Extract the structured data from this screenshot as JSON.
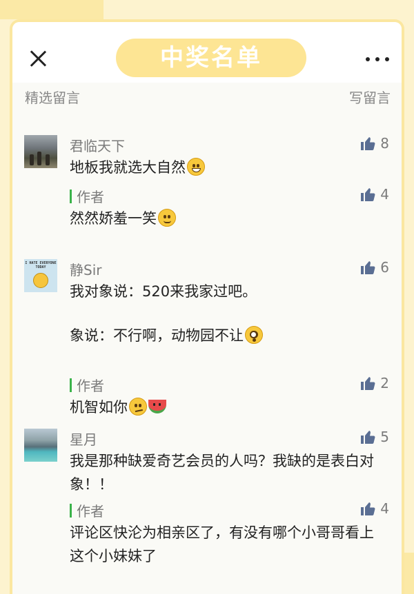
{
  "header": {
    "title": "中奖名单",
    "section_label": "精选留言",
    "write_label": "写留言"
  },
  "comments": [
    {
      "author": "君临天下",
      "likes": "8",
      "text": "地板我就选大自然",
      "emoji": "grin-emoji",
      "reply": {
        "label": "作者",
        "likes": "4",
        "text": "然然娇羞一笑",
        "emoji": "shy-smile-emoji"
      }
    },
    {
      "author": "静Sir",
      "likes": "6",
      "avatar_text": "I HATE EVERYONE TODAY",
      "text_line1": "我对象说：520来我家过吧。",
      "text_line2": "象说：不行啊，动物园不让",
      "emoji": "flushed-emoji",
      "reply": {
        "label": "作者",
        "likes": "2",
        "text": "机智如你",
        "emoji": "smirk-emoji",
        "emoji2": "watermelon-emoji"
      }
    },
    {
      "author": "星月",
      "likes": "5",
      "text": "我是那种缺爱奇艺会员的人吗？我缺的是表白对象！！",
      "reply": {
        "label": "作者",
        "likes": "4",
        "text": "评论区快沦为相亲区了，有没有哪个小哥哥看上这个小妹妹了"
      }
    }
  ],
  "colors": {
    "background": "#fdf3cf",
    "title_pill": "#fde594",
    "reply_bar": "#3bb34a",
    "thumb": "#5a6e93"
  }
}
